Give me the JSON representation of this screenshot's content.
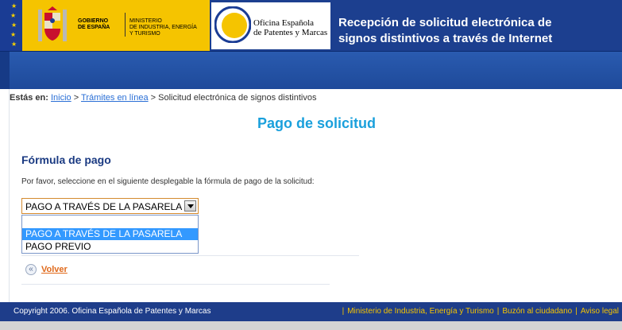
{
  "header": {
    "gov_line1": "GOBIERNO",
    "gov_line2": "DE ESPAÑA",
    "ministry_line1": "MINISTERIO",
    "ministry_line2": "DE INDUSTRIA, ENERGÍA",
    "ministry_line3": "Y TURISMO",
    "office_line1": "Oficina Española",
    "office_line2": "de Patentes y Marcas",
    "title_line1": "Recepción de solicitud electrónica de",
    "title_line2": "signos distintivos a través de Internet"
  },
  "breadcrumb": {
    "label": "Estás en:",
    "home": "Inicio",
    "sep1": " > ",
    "online": "Trámites en línea",
    "sep2": " > ",
    "current": "Solicitud electrónica de signos distintivos"
  },
  "main": {
    "page_title": "Pago de solicitud",
    "section_title": "Fórmula de pago",
    "instructions": "Por favor, seleccione en el siguiente desplegable la fórmula de pago de la solicitud:",
    "select_value": "PAGO A TRAVÉS DE LA PASARELA",
    "options": [
      "",
      "PAGO A TRAVÉS DE LA PASARELA",
      "PAGO PREVIO"
    ],
    "back_label": "Volver"
  },
  "footer": {
    "copyright": "Copyright 2006. Oficina Española de Patentes y Marcas",
    "link_ministry": "Ministerio de Industria, Energía y Turismo",
    "link_mailbox": "Buzón al ciudadano",
    "link_legal": "Aviso legal",
    "separator": "|"
  },
  "colors": {
    "header_blue": "#1c3f8f",
    "gov_yellow": "#f5c400",
    "title_cyan": "#1aa0dc",
    "link_blue": "#2a6fd6",
    "back_orange": "#e06a1c",
    "option_selected": "#3399ff"
  },
  "icons": [
    "eu-flag-icon",
    "coat-of-arms-icon",
    "oepm-logo-icon",
    "dropdown-arrow-icon",
    "back-double-chevron-icon"
  ]
}
